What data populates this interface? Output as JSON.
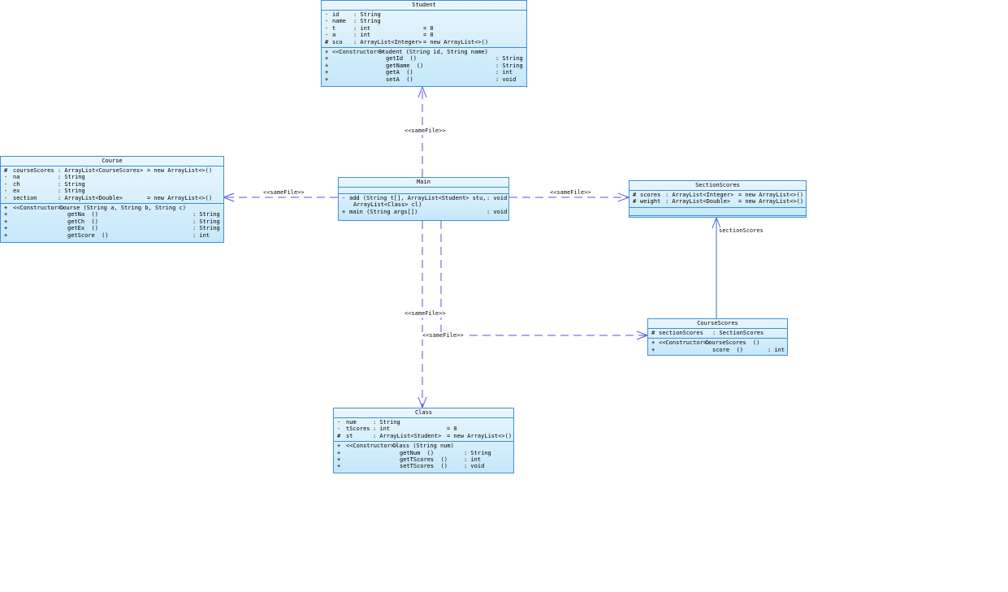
{
  "classes": {
    "student": {
      "title": "Student",
      "attributes": [
        {
          "vis": "-",
          "name": "id",
          "type": ": String",
          "init": ""
        },
        {
          "vis": "-",
          "name": "name",
          "type": ": String",
          "init": ""
        },
        {
          "vis": "-",
          "name": "t",
          "type": ": int",
          "init": "= 0"
        },
        {
          "vis": "-",
          "name": "a",
          "type": ": int",
          "init": "= 0"
        },
        {
          "vis": "#",
          "name": "sco",
          "type": ": ArrayList<Integer>",
          "init": "= new ArrayList<>()"
        }
      ],
      "operations": [
        {
          "vis": "+",
          "stereo": "<<Constructor>>",
          "sig": "Student (String id, String name)",
          "ret": ""
        },
        {
          "vis": "+",
          "stereo": "",
          "sig": "getId  ()",
          "ret": ": String"
        },
        {
          "vis": "+",
          "stereo": "",
          "sig": "getName  ()",
          "ret": ": String"
        },
        {
          "vis": "+",
          "stereo": "",
          "sig": "getA  ()",
          "ret": ": int"
        },
        {
          "vis": "+",
          "stereo": "",
          "sig": "setA  ()",
          "ret": ": void"
        }
      ]
    },
    "course": {
      "title": "Course",
      "attributes": [
        {
          "vis": "#",
          "name": "courseScores",
          "type": ": ArrayList<CourseScores>",
          "init": "= new ArrayList<>()"
        },
        {
          "vis": "-",
          "name": "na",
          "type": ": String",
          "init": ""
        },
        {
          "vis": "-",
          "name": "ch",
          "type": ": String",
          "init": ""
        },
        {
          "vis": "-",
          "name": "ex",
          "type": ": String",
          "init": ""
        },
        {
          "vis": "-",
          "name": "section",
          "type": ": ArrayList<Double>",
          "init": "= new ArrayList<>()"
        }
      ],
      "operations": [
        {
          "vis": "+",
          "stereo": "<<Constructor>>",
          "sig": "Course (String a, String b, String c)",
          "ret": ""
        },
        {
          "vis": "+",
          "stereo": "",
          "sig": "getNa  ()",
          "ret": ": String"
        },
        {
          "vis": "+",
          "stereo": "",
          "sig": "getCh  ()",
          "ret": ": String"
        },
        {
          "vis": "+",
          "stereo": "",
          "sig": "getEx  ()",
          "ret": ": String"
        },
        {
          "vis": "+",
          "stereo": "",
          "sig": "getScore  ()",
          "ret": ": int"
        }
      ]
    },
    "main": {
      "title": "Main",
      "attributes": [],
      "operations": [
        {
          "vis": "-",
          "stereo": "",
          "sig": "add (String t[], ArrayList<Student> stu,",
          "ret": ": void"
        },
        {
          "vis": "",
          "stereo": "",
          "sig": "ArrayList<Class> cl)",
          "ret": ""
        },
        {
          "vis": "+",
          "stereo": "",
          "sig": "main (String args[])",
          "ret": ": void"
        }
      ]
    },
    "sectionScores": {
      "title": "SectionScores",
      "attributes": [
        {
          "vis": "#",
          "name": "scores",
          "type": ": ArrayList<Integer>",
          "init": "= new ArrayList<>()"
        },
        {
          "vis": "#",
          "name": "weight",
          "type": ": ArrayList<Double>",
          "init": "= new ArrayList<>()"
        }
      ],
      "operations": []
    },
    "courseScores": {
      "title": "CourseScores",
      "attributes": [
        {
          "vis": "#",
          "name": "sectionScores",
          "type": ": SectionScores",
          "init": ""
        }
      ],
      "operations": [
        {
          "vis": "+",
          "stereo": "<<Constructor>>",
          "sig": "CourseScores  ()",
          "ret": ""
        },
        {
          "vis": "+",
          "stereo": "",
          "sig": "score  ()",
          "ret": ": int"
        }
      ]
    },
    "class": {
      "title": "Class",
      "attributes": [
        {
          "vis": "-",
          "name": "num",
          "type": ": String",
          "init": ""
        },
        {
          "vis": "-",
          "name": "tScores",
          "type": ": int",
          "init": "= 0"
        },
        {
          "vis": "#",
          "name": "st",
          "type": ": ArrayList<Student>",
          "init": "= new ArrayList<>()"
        }
      ],
      "operations": [
        {
          "vis": "+",
          "stereo": "<<Constructor>>",
          "sig": "Class (String num)",
          "ret": ""
        },
        {
          "vis": "+",
          "stereo": "",
          "sig": "getNum  ()",
          "ret": ": String"
        },
        {
          "vis": "+",
          "stereo": "",
          "sig": "getTScores  ()",
          "ret": ": int"
        },
        {
          "vis": "+",
          "stereo": "",
          "sig": "setTScores  ()",
          "ret": ": void"
        }
      ]
    }
  },
  "edges": {
    "main_student": "<<sameFile>>",
    "main_course": "<<sameFile>>",
    "main_sectionScores": "<<sameFile>>",
    "main_class": "<<sameFile>>",
    "main_courseScores": "<<sameFile>>",
    "courseScores_sectionScores": "sectionScores"
  }
}
